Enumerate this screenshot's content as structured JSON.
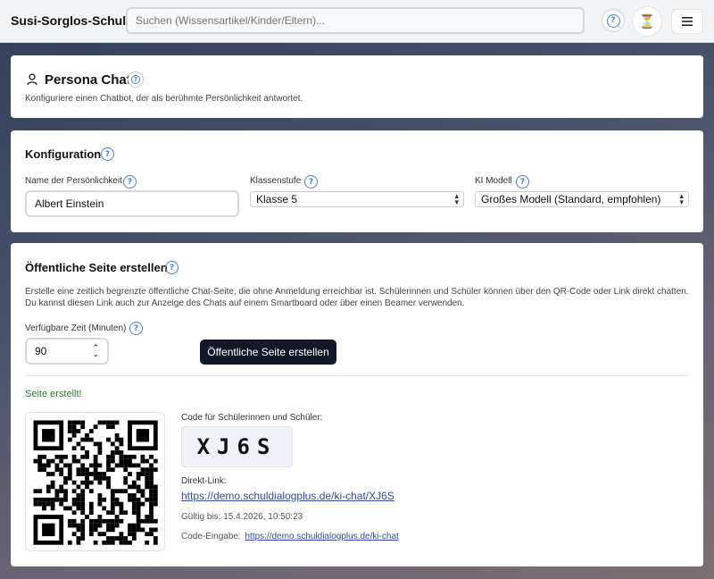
{
  "header": {
    "app_title": "Susi-Sorglos-Schule",
    "search_placeholder": "Suchen (Wissensartikel/Kinder/Eltern)...",
    "help_icon": "question-circle-icon",
    "timer_icon": "hourglass-icon",
    "menu_icon": "hamburger-menu-icon"
  },
  "persona_card": {
    "title": "Persona Chat",
    "description": "Konfiguriere einen Chatbot, der als berühmte Persönlichkeit antwortet."
  },
  "config_card": {
    "title": "Konfiguration",
    "name_label": "Name der Persönlichkeit",
    "name_value": "Albert Einstein",
    "grade_label": "Klassenstufe",
    "grade_value": "Klasse 5",
    "model_label": "KI Modell",
    "model_value": "Großes Modell (Standard, empfohlen)"
  },
  "public_card": {
    "title": "Öffentliche Seite erstellen",
    "description": "Erstelle eine zeitlich begrenzte öffentliche Chat-Seite, die ohne Anmeldung erreichbar ist. Schülerinnen und Schüler können über den QR-Code oder Link direkt chatten. Du kannst diesen Link auch zur Anzeige des Chats auf einem Smartboard oder über einen Beamer verwenden.",
    "time_label": "Verfügbare Zeit (Minuten)",
    "time_value": "90",
    "create_button": "Öffentliche Seite erstellen",
    "success_message": "Seite erstellt!",
    "code_label": "Code für Schülerinnen und Schüler:",
    "code": "XJ6S",
    "direct_link_label": "Direkt-Link:",
    "direct_link": "https://demo.schuldialogplus.de/ki-chat/XJ6S",
    "valid_until": "Gültig bis: 15.4.2026, 10:50:23",
    "code_entry_label": "Code-Eingabe:",
    "code_entry_link": "https://demo.schuldialogplus.de/ki-chat"
  },
  "colors": {
    "accent": "#4a7fd4",
    "success": "#2e7d32",
    "dark_button": "#111827",
    "link": "#2f4ea3"
  }
}
